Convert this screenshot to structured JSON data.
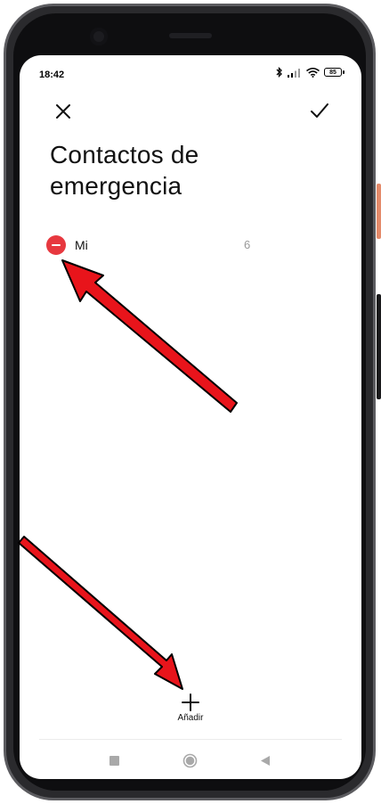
{
  "status_bar": {
    "time": "18:42",
    "battery": "85",
    "icons": [
      "bluetooth-icon",
      "signal-icon",
      "wifi-icon",
      "battery-icon"
    ]
  },
  "header": {
    "close_icon": "close-icon",
    "confirm_icon": "check-icon"
  },
  "title": {
    "line1": "Contactos de",
    "line2": "emergencia"
  },
  "contacts": [
    {
      "name": "Mi",
      "count": "6"
    }
  ],
  "add_button": {
    "label": "Añadir",
    "icon": "plus-icon"
  },
  "nav_bar": {
    "icons": [
      "recents-square-icon",
      "home-circle-icon",
      "back-triangle-icon"
    ]
  },
  "colors": {
    "remove_red": "#e7383f",
    "annotation_arrow": "#e8141b",
    "phone_frame": "#2a2a2d",
    "side_button": "#e48a6a"
  }
}
